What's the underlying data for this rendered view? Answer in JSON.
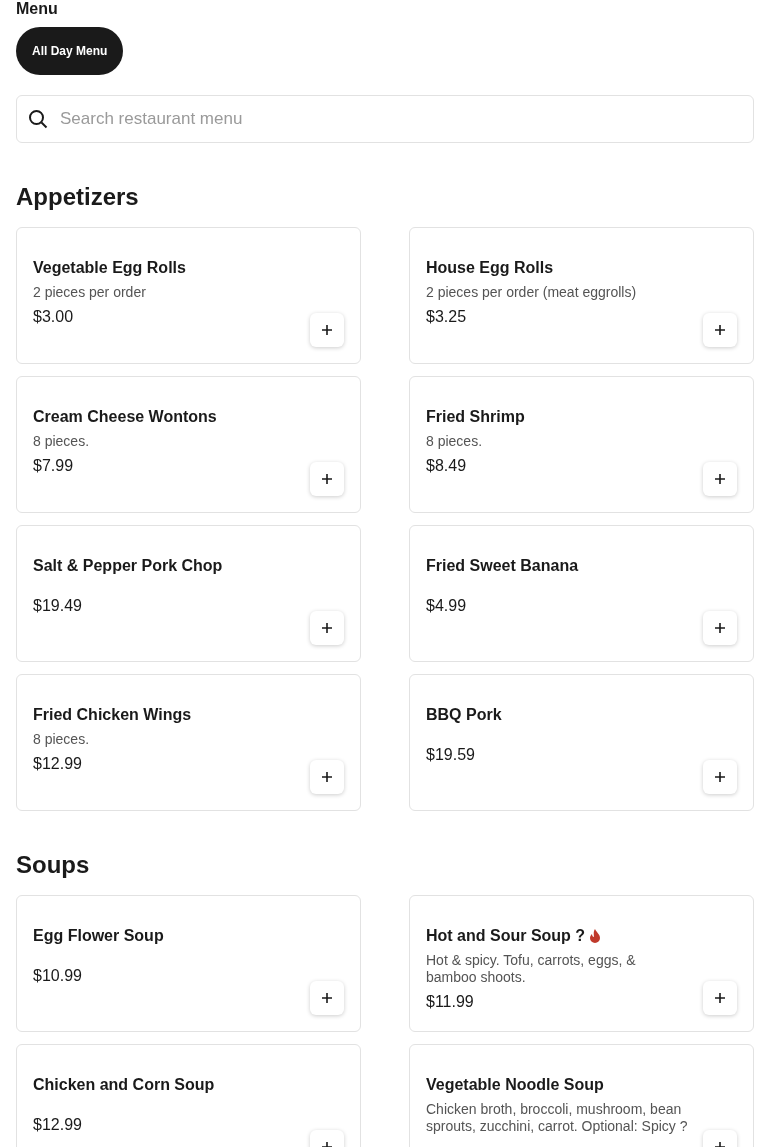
{
  "heading": "Menu",
  "menus": [
    {
      "label": "All Day Menu",
      "selected": true
    }
  ],
  "search": {
    "placeholder": "Search restaurant menu"
  },
  "sections": [
    {
      "title": "Appetizers",
      "items": [
        {
          "name": "Vegetable Egg Rolls",
          "description": "2 pieces per order",
          "price": "$3.00",
          "spicy": false
        },
        {
          "name": "House Egg Rolls",
          "description": "2 pieces per order (meat eggrolls)",
          "price": "$3.25",
          "spicy": false
        },
        {
          "name": "Cream Cheese Wontons",
          "description": "8 pieces.",
          "price": "$7.99",
          "spicy": false
        },
        {
          "name": "Fried Shrimp",
          "description": "8 pieces.",
          "price": "$8.49",
          "spicy": false
        },
        {
          "name": "Salt & Pepper Pork Chop",
          "price": "$19.49",
          "spicy": false
        },
        {
          "name": "Fried Sweet Banana",
          "price": "$4.99",
          "spicy": false
        },
        {
          "name": "Fried Chicken Wings",
          "description": "8 pieces.",
          "price": "$12.99",
          "spicy": false
        },
        {
          "name": "BBQ Pork",
          "price": "$19.59",
          "spicy": false
        }
      ]
    },
    {
      "title": "Soups",
      "items": [
        {
          "name": "Egg Flower Soup",
          "price": "$10.99",
          "spicy": false
        },
        {
          "name": "Hot and Sour Soup ?",
          "description": "Hot & spicy. Tofu, carrots, eggs, & bamboo shoots.",
          "price": "$11.99",
          "spicy": true
        },
        {
          "name": "Chicken and Corn Soup",
          "price": "$12.99",
          "spicy": false
        },
        {
          "name": "Vegetable Noodle Soup",
          "description": "Chicken broth, broccoli, mushroom, bean sprouts, zucchini, carrot. Optional: Spicy ?",
          "spicy": false
        }
      ]
    }
  ]
}
